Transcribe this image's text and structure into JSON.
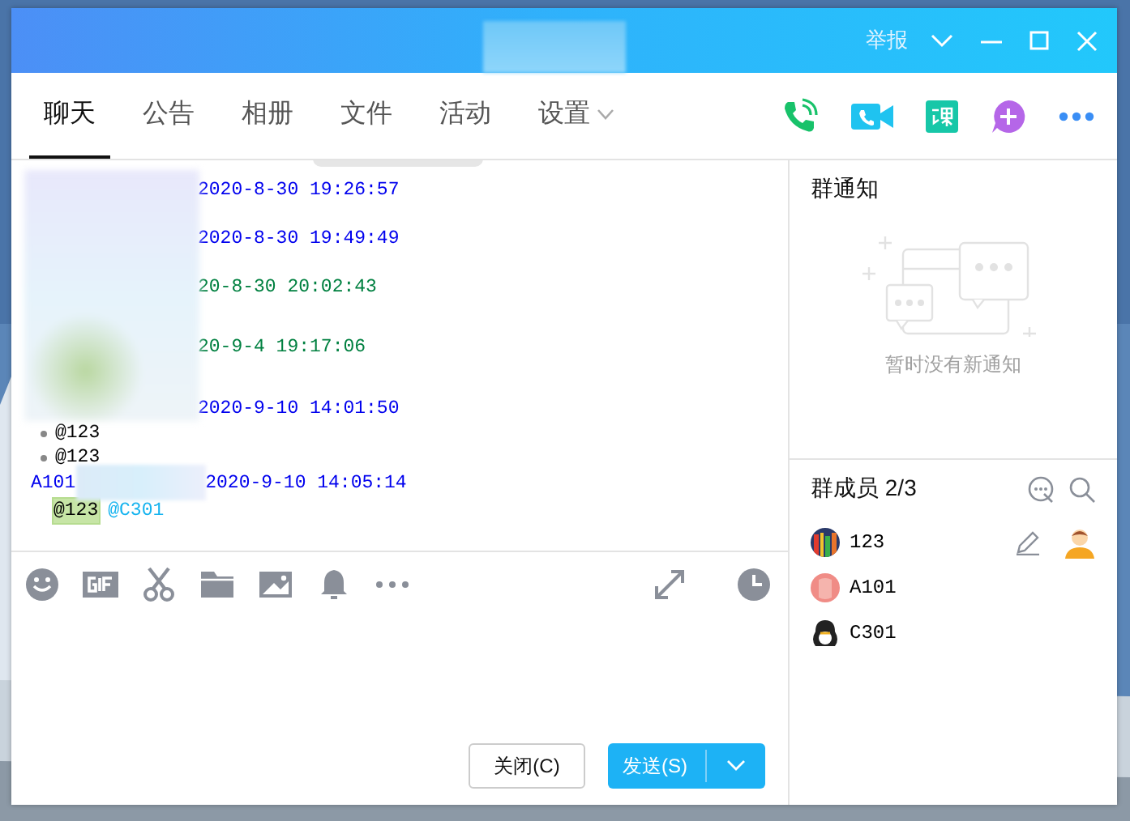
{
  "title_bar": {
    "report": "举报"
  },
  "tabs": [
    {
      "label": "聊天",
      "selected": true,
      "kind": "plain"
    },
    {
      "label": "公告",
      "selected": false,
      "kind": "plain"
    },
    {
      "label": "相册",
      "selected": false,
      "kind": "plain"
    },
    {
      "label": "文件",
      "selected": false,
      "kind": "plain"
    },
    {
      "label": "活动",
      "selected": false,
      "kind": "plain"
    },
    {
      "label": "设置",
      "selected": false,
      "kind": "dropdown"
    }
  ],
  "messages": [
    {
      "timestamp": "2020-8-30 19:26:57",
      "kind": "self"
    },
    {
      "timestamp": "2020-8-30 19:49:49",
      "kind": "self"
    },
    {
      "timestamp": "20-8-30 20:02:43",
      "kind": "other"
    },
    {
      "timestamp": "20-9-4 19:17:06",
      "kind": "other"
    },
    {
      "timestamp": "2020-9-10 14:01:50",
      "kind": "self",
      "lines": [
        "@123",
        "@123"
      ]
    },
    {
      "sender": "A101",
      "timestamp": "2020-9-10 14:05:14",
      "kind": "self",
      "mentions": [
        {
          "text": "@123",
          "highlighted": true
        },
        {
          "text": "@C301",
          "highlighted": false
        }
      ]
    }
  ],
  "notice": {
    "title": "群通知",
    "empty_text": "暂时没有新通知"
  },
  "members": {
    "title": "群成员 2/3",
    "list": [
      {
        "name": "123",
        "owner": true,
        "kind": "stripes"
      },
      {
        "name": "A101",
        "owner": false,
        "kind": "pink"
      },
      {
        "name": "C301",
        "owner": false,
        "kind": "penguin"
      }
    ]
  },
  "buttons": {
    "close": "关闭(C)",
    "send": "发送(S)"
  }
}
